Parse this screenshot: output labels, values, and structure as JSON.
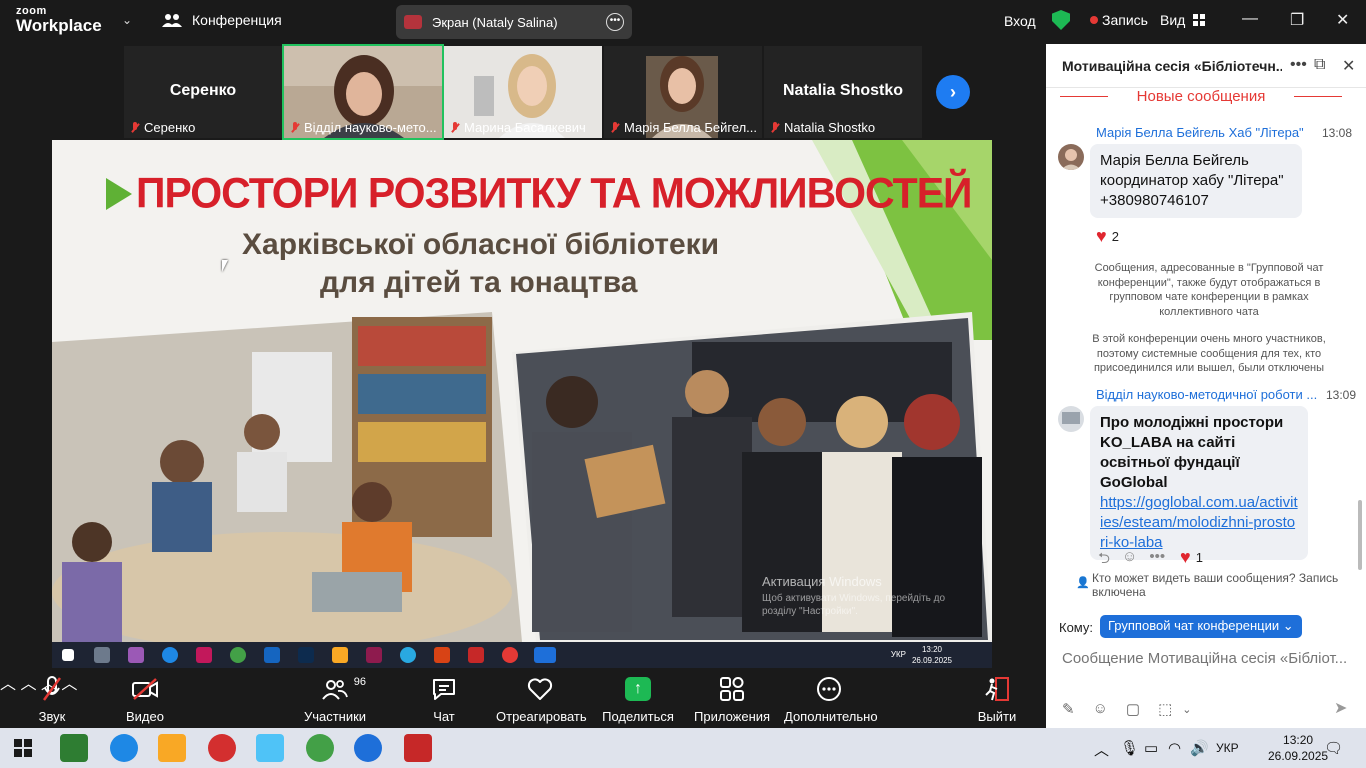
{
  "app": {
    "logo_line1": "zoom",
    "logo_line2": "Workplace",
    "conference_label": "Конференция",
    "screen_share_label": "Экран (Nataly Salina)",
    "login_label": "Вход",
    "record_label": "Запись",
    "view_label": "Вид"
  },
  "participants": [
    {
      "name_big": "Серенко",
      "caption": "Серенко",
      "video": false
    },
    {
      "name_big": "",
      "caption": "Відділ науково-мето...",
      "video": true,
      "active": true
    },
    {
      "name_big": "",
      "caption": "Марина Басалкевич",
      "video": true
    },
    {
      "name_big": "",
      "caption": "Марія Белла Бейгел...",
      "video": true
    },
    {
      "name_big": "Natalia Shostko",
      "caption": "Natalia Shostko",
      "video": false
    }
  ],
  "slide": {
    "title": "ПРОСТОРИ РОЗВИТКУ ТА МОЖЛИВОСТЕЙ",
    "subtitle1": "Харківської обласної бібліотеки",
    "subtitle2": "для дітей та юнацтва",
    "watermark1": "Активация Windows",
    "watermark2": "Щоб активувати Windows, перейдіть до розділу \"Настройки\".",
    "taskbar_lang": "УКР",
    "taskbar_time": "13:20",
    "taskbar_date": "26.09.2025"
  },
  "toolbar": {
    "audio": "Звук",
    "video": "Видео",
    "participants": "Участники",
    "participants_count": "96",
    "chat": "Чат",
    "react": "Отреагировать",
    "share": "Поделиться",
    "apps": "Приложения",
    "more": "Дополнительно",
    "leave": "Выйти"
  },
  "chat": {
    "title": "Мотиваційна сесія «Бібліотечн...",
    "new_messages": "Новые сообщения",
    "messages": [
      {
        "sender": "Марія Белла Бейгель Хаб \"Літера\"",
        "time": "13:08",
        "text": "Марія Белла Бейгель координатор хабу \"Літера\" +380980746107",
        "reaction_count": "2"
      },
      {
        "sender": "Відділ науково-методичної роботи ...",
        "time": "13:09",
        "text_bold": "Про молодіжні простори KO_LABA на сайті освітньої фундації GoGlobal",
        "link": "https://goglobal.com.ua/activities/esteam/molodizhni-prostori-ko-laba",
        "reaction_count": "1"
      }
    ],
    "system_msg1": "Сообщения, адресованные в \"Групповой чат конференции\", также будут отображаться в групповом чате конференции в рамках коллективного чата",
    "system_msg2": "В этой конференции очень много участников, поэтому системные сообщения для тех, кто присоединился или вышел, были отключены",
    "who_sees": "Кто может видеть ваши сообщения? Запись включена",
    "to_label": "Кому:",
    "to_value": "Групповой чат конференции",
    "input_placeholder": "Сообщение Мотиваційна сесія «Бібліот..."
  },
  "os_taskbar": {
    "lang": "УКР",
    "time": "13:20",
    "date": "26.09.2025"
  },
  "colors": {
    "zoom_blue": "#1e6fd9",
    "share_green": "#1db954",
    "mute_red": "#e53935",
    "slide_red": "#d7202a",
    "slide_green": "#5fb135"
  }
}
